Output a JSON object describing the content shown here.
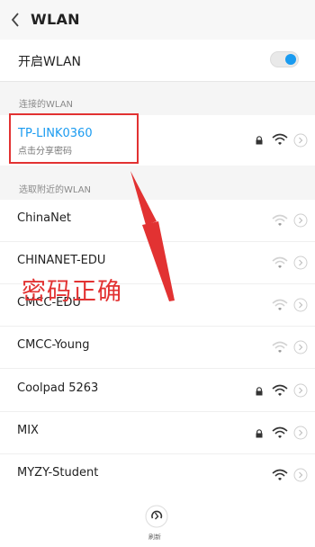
{
  "header": {
    "title": "WLAN"
  },
  "wlan_toggle": {
    "label": "开启WLAN",
    "on": true,
    "accent": "#1a9bf0"
  },
  "connected_section": {
    "header": "连接的WLAN",
    "network": {
      "name": "TP-LINK0360",
      "subtitle": "点击分享密码",
      "name_color": "#1a9bf0"
    }
  },
  "nearby_section": {
    "header": "选取附近的WLAN",
    "networks": [
      {
        "name": "ChinaNet",
        "locked": false,
        "signal": "weak"
      },
      {
        "name": "CHINANET-EDU",
        "locked": false,
        "signal": "weak"
      },
      {
        "name": "CMCC-EDU",
        "locked": false,
        "signal": "weak"
      },
      {
        "name": "CMCC-Young",
        "locked": false,
        "signal": "weak"
      },
      {
        "name": "Coolpad 5263",
        "locked": true,
        "signal": "strong"
      },
      {
        "name": "MIX",
        "locked": true,
        "signal": "strong"
      },
      {
        "name": "MYZY-Student",
        "locked": false,
        "signal": "strong"
      }
    ]
  },
  "annotation": {
    "text": "密码正确",
    "color": "#e23232"
  },
  "bottom_bar": {
    "refresh_label": "刷新"
  },
  "icons": [
    "back-icon",
    "lock-icon",
    "wifi-icon",
    "chevron-right-icon",
    "refresh-icon"
  ]
}
